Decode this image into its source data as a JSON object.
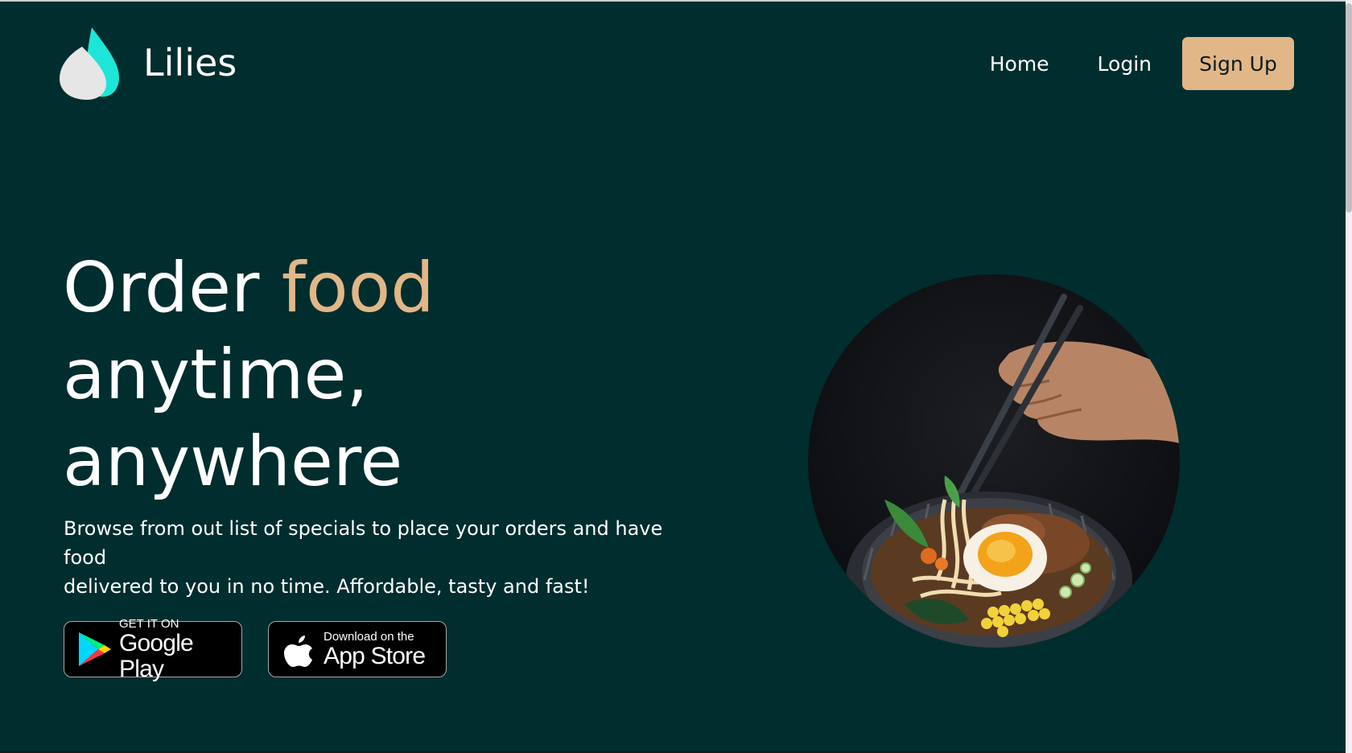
{
  "brand": {
    "name": "Lilies"
  },
  "nav": {
    "home": "Home",
    "login": "Login",
    "signup": "Sign Up"
  },
  "hero": {
    "title_part1": "Order ",
    "title_accent": "food",
    "title_line2": "anytime,",
    "title_line3": "anywhere",
    "description_line1": "Browse from out list of specials to place your orders and have food",
    "description_line2": "delivered to you in no time. Affordable, tasty and fast!"
  },
  "stores": {
    "google_play": {
      "small": "GET IT ON",
      "big": "Google Play"
    },
    "app_store": {
      "small": "Download on the",
      "big": "App Store"
    }
  },
  "colors": {
    "background": "#002d2e",
    "accent": "#e1b788",
    "logo_cyan": "#1de6d6",
    "logo_gray": "#e6e6e6"
  },
  "icons": {
    "logo": "lily-drop-logo",
    "google_play": "google-play-triangle-icon",
    "apple": "apple-icon"
  }
}
